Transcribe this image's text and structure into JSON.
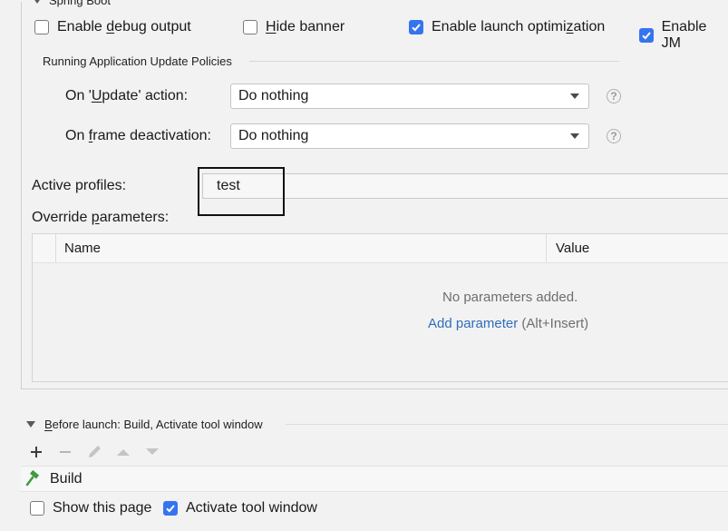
{
  "spring_boot": {
    "section_label": "Spring Boot",
    "checkboxes": [
      {
        "label_pre": "Enable ",
        "mnemonic": "d",
        "label_post": "ebug output",
        "checked": false
      },
      {
        "label_pre": "",
        "mnemonic": "H",
        "label_post": "ide banner",
        "checked": false
      },
      {
        "label_pre": "Enable launch optimi",
        "mnemonic": "z",
        "label_post": "ation",
        "checked": true
      },
      {
        "label_pre": "Enable JM",
        "mnemonic": "",
        "label_post": "",
        "checked": true
      }
    ]
  },
  "update_policies": {
    "title": "Running Application Update Policies",
    "on_update": {
      "label_pre": "On '",
      "mnemonic": "U",
      "label_post": "pdate' action:",
      "value": "Do nothing"
    },
    "on_frame": {
      "label_pre": "On ",
      "mnemonic": "f",
      "label_post": "rame deactivation:",
      "value": "Do nothing"
    },
    "help_glyph": "?"
  },
  "active_profiles": {
    "label": "Active profiles:",
    "value": "test"
  },
  "override_parameters": {
    "label_pre": "Override ",
    "mnemonic": "p",
    "label_post": "arameters:",
    "columns": [
      "Name",
      "Value"
    ],
    "empty_text": "No parameters added.",
    "add_link": "Add parameter",
    "add_hint": "(Alt+Insert)"
  },
  "before_launch": {
    "label_pre": "",
    "mnemonic": "B",
    "label_post": "efore launch: Build, Activate tool window",
    "toolbar_icons": [
      "plus-icon",
      "minus-icon",
      "pencil-icon",
      "arrow-up-icon",
      "arrow-down-icon"
    ],
    "tasks": [
      {
        "icon": "hammer-icon",
        "label": "Build"
      }
    ]
  },
  "bottom_options": {
    "show_page": {
      "label": "Show this page",
      "checked": false
    },
    "activate_tool": {
      "label": "Activate tool window",
      "checked": true
    }
  },
  "colors": {
    "accent": "#3574f0",
    "link": "#2f6dbc",
    "build_icon": "#3f9a3a"
  }
}
